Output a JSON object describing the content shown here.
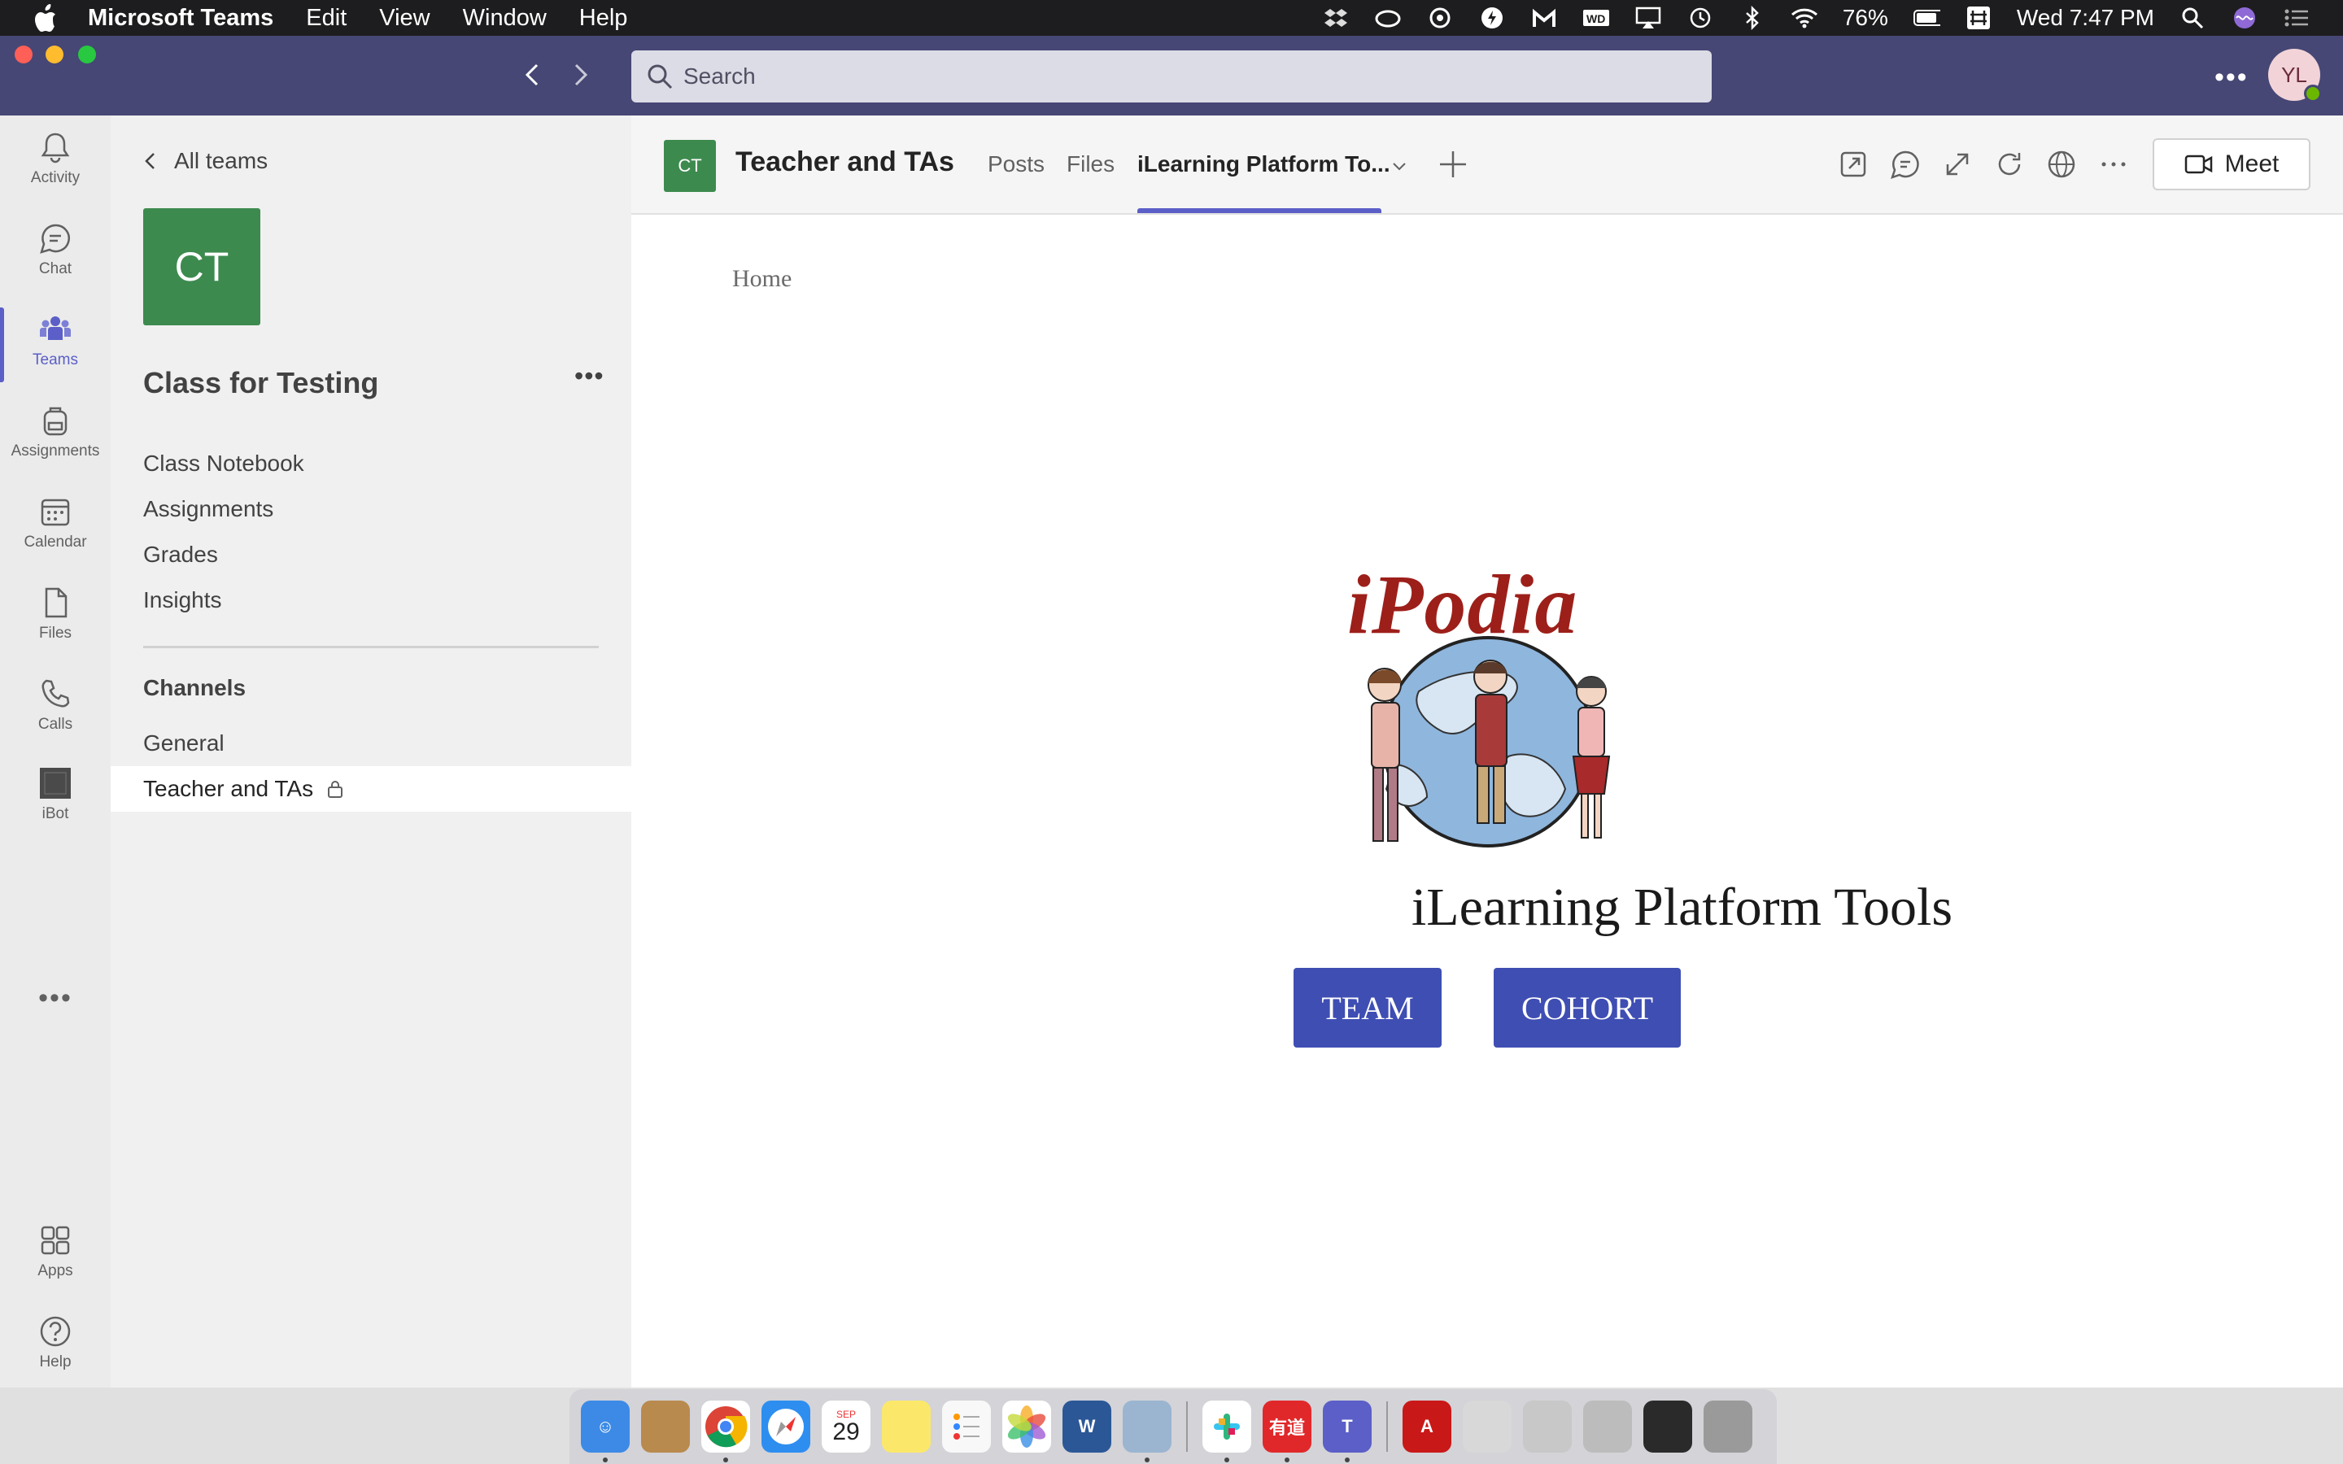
{
  "menubar": {
    "app_name": "Microsoft Teams",
    "menus": [
      "Edit",
      "View",
      "Window",
      "Help"
    ],
    "battery": "76%",
    "clock": "Wed 7:47 PM"
  },
  "titlebar": {
    "search_placeholder": "Search",
    "avatar_initials": "YL"
  },
  "rail": {
    "items": [
      {
        "label": "Activity",
        "icon": "bell-icon"
      },
      {
        "label": "Chat",
        "icon": "chat-icon"
      },
      {
        "label": "Teams",
        "icon": "teams-icon"
      },
      {
        "label": "Assignments",
        "icon": "backpack-icon"
      },
      {
        "label": "Calendar",
        "icon": "calendar-icon"
      },
      {
        "label": "Files",
        "icon": "file-icon"
      },
      {
        "label": "Calls",
        "icon": "phone-icon"
      },
      {
        "label": "iBot",
        "icon": "ibot-icon"
      }
    ],
    "bottom": [
      {
        "label": "Apps",
        "icon": "apps-icon"
      },
      {
        "label": "Help",
        "icon": "help-icon"
      }
    ]
  },
  "team": {
    "back_label": "All teams",
    "avatar_initials": "CT",
    "name": "Class for Testing",
    "tabs": [
      "Class Notebook",
      "Assignments",
      "Grades",
      "Insights"
    ],
    "channels_label": "Channels",
    "channels": [
      "General",
      "Teacher and TAs"
    ]
  },
  "channel_header": {
    "avatar_initials": "CT",
    "title": "Teacher and TAs",
    "tabs": [
      "Posts",
      "Files",
      "iLearning Platform To..."
    ],
    "meet_label": "Meet"
  },
  "content": {
    "breadcrumb": "Home",
    "logo_text": "iPodia",
    "platform_title": "iLearning Platform Tools",
    "buttons": [
      "TEAM",
      "COHORT"
    ]
  },
  "dock": {
    "calendar_date": "29",
    "calendar_month": "SEP",
    "youdao_label": "有道"
  },
  "colors": {
    "teams_purple": "#464775",
    "accent": "#5b5fc7",
    "team_green": "#3d8a4f",
    "button_blue": "#3f4eb3",
    "logo_red": "#9d1f1a"
  }
}
